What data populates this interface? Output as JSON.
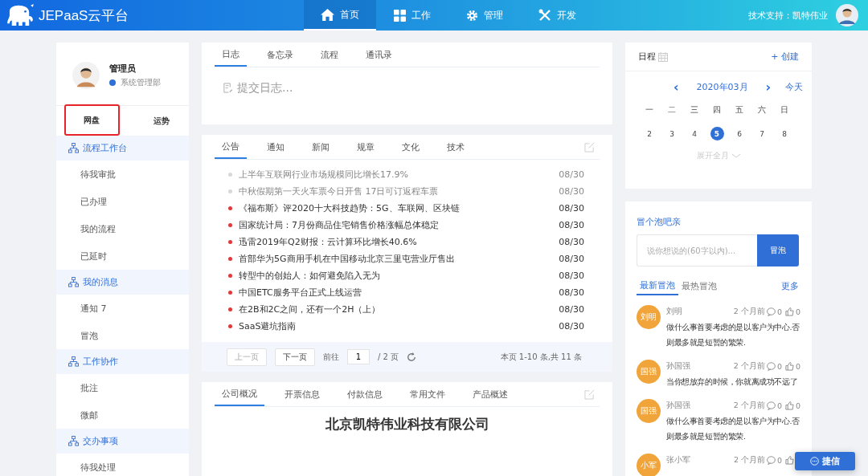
{
  "header": {
    "logo_text": "JEPaaS云平台",
    "nav": [
      {
        "label": "首页",
        "selected": true
      },
      {
        "label": "工作",
        "selected": false
      },
      {
        "label": "管理",
        "selected": false
      },
      {
        "label": "开发",
        "selected": false
      }
    ],
    "support": "技术支持：凯特伟业"
  },
  "profile": {
    "name": "管理员",
    "department": "系统管理部",
    "tabs": [
      {
        "label": "网盘",
        "highlighted": true
      },
      {
        "label": "运势",
        "highlighted": false
      }
    ]
  },
  "sidebar": {
    "groups": [
      {
        "title": "流程工作台",
        "items": [
          "待我审批",
          "已办理",
          "我的流程",
          "已延时"
        ]
      },
      {
        "title": "我的消息",
        "items": [
          "通知 7",
          "冒泡"
        ]
      },
      {
        "title": "工作协作",
        "items": [
          "批注",
          "微邮"
        ]
      },
      {
        "title": "交办事项",
        "items": [
          "待我处理"
        ]
      }
    ]
  },
  "log_card": {
    "tabs": [
      {
        "label": "日志",
        "selected": true
      },
      {
        "label": "备忘录",
        "selected": false
      },
      {
        "label": "流程",
        "selected": false
      },
      {
        "label": "通讯录",
        "selected": false
      }
    ],
    "placeholder": "提交日志..."
  },
  "news_card": {
    "tabs": [
      {
        "label": "公告",
        "selected": true
      },
      {
        "label": "通知",
        "selected": false
      },
      {
        "label": "新闻",
        "selected": false
      },
      {
        "label": "规章",
        "selected": false
      },
      {
        "label": "文化",
        "selected": false
      },
      {
        "label": "技术",
        "selected": false
      }
    ],
    "items": [
      {
        "title": "上半年互联网行业市场规模同比增长17.9%",
        "date": "08/30",
        "read": true
      },
      {
        "title": "中秋假期第一天火车票今日开售 17日可订返程车票",
        "date": "08/30",
        "read": true
      },
      {
        "title": "《福布斯》评2020十大科技趋势：5G、车联网、区块链",
        "date": "08/30",
        "read": false
      },
      {
        "title": "国家统计局：7月份商品住宅销售价格涨幅总体稳定",
        "date": "08/30",
        "read": false
      },
      {
        "title": "迅雷2019年Q2财报：云计算环比增长40.6%",
        "date": "08/30",
        "read": false
      },
      {
        "title": "首部华为5G商用手机在中国移动北京三里屯营业厅售出",
        "date": "08/30",
        "read": false
      },
      {
        "title": "转型中的创始人：如何避免陷入无为",
        "date": "08/30",
        "read": false
      },
      {
        "title": "中国ETC服务平台正式上线运营",
        "date": "08/30",
        "read": false
      },
      {
        "title": "在2B和2C之间，还有一个2H（上）",
        "date": "08/30",
        "read": false
      },
      {
        "title": "SaaS避坑指南",
        "date": "08/30",
        "read": false
      }
    ],
    "pager": {
      "prev": "上一页",
      "prev_disabled": true,
      "next": "下一页",
      "goto": "前往",
      "page": "1",
      "total": "/ 2 页",
      "summary": "本页 1-10 条,共 11 条"
    }
  },
  "company_card": {
    "tabs": [
      {
        "label": "公司概况",
        "selected": true
      },
      {
        "label": "开票信息",
        "selected": false
      },
      {
        "label": "付款信息",
        "selected": false
      },
      {
        "label": "常用文件",
        "selected": false
      },
      {
        "label": "产品概述",
        "selected": false
      }
    ],
    "heading": "北京凯特伟业科技有限公司"
  },
  "calendar": {
    "title": "日程",
    "create": "+ 创建",
    "prev": "‹",
    "month": "2020年03月",
    "next": "›",
    "today": "今天",
    "weekdays": [
      "一",
      "二",
      "三",
      "四",
      "五",
      "六",
      "日"
    ],
    "days": [
      {
        "label": "2",
        "selected": false
      },
      {
        "label": "3",
        "selected": false
      },
      {
        "label": "4",
        "selected": false
      },
      {
        "label": "5",
        "selected": true
      },
      {
        "label": "6",
        "selected": false
      },
      {
        "label": "7",
        "selected": false
      },
      {
        "label": "8",
        "selected": false
      }
    ],
    "expand": "展开全月"
  },
  "bubble": {
    "title": "冒个泡吧亲",
    "placeholder": "说你想说的(60字以内)...",
    "submit": "冒泡",
    "tabs": [
      {
        "label": "最新冒泡",
        "selected": true
      },
      {
        "label": "最热冒泡",
        "selected": false
      }
    ],
    "more": "更多",
    "posts": [
      {
        "avatar": "刘明",
        "name": "刘明",
        "time": "2 个月前",
        "comments": "0",
        "likes": "0",
        "text": "做什么事首要考虑的是以客户为中心.否则最多就是短暂的繁荣."
      },
      {
        "avatar": "国强",
        "name": "孙国强",
        "time": "2 个月前",
        "comments": "0",
        "likes": "0",
        "text": "当你想放弃的时候，你就离成功不远了"
      },
      {
        "avatar": "国强",
        "name": "孙国强",
        "time": "2 个月前",
        "comments": "0",
        "likes": "0",
        "text": "做什么事首要考虑的是以客户为中心.否则最多就是短暂的繁荣."
      },
      {
        "avatar": "小军",
        "name": "张小军",
        "time": "2 个月前",
        "comments": "0"
      }
    ]
  },
  "chat_button": "捷信"
}
